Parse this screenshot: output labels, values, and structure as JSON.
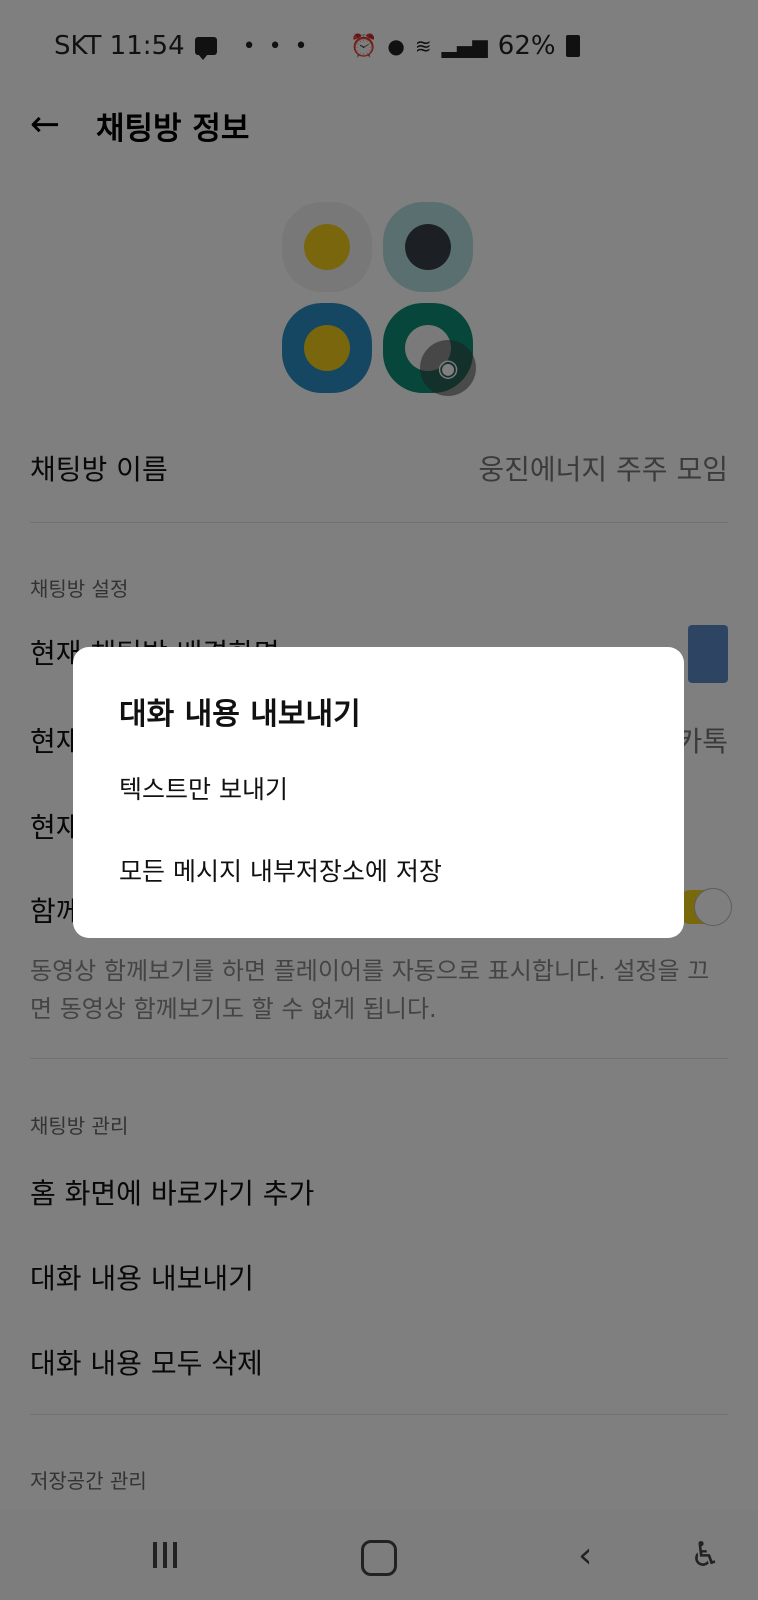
{
  "status_bar": {
    "carrier_time": "SKT 11:54",
    "dots": "• • •",
    "battery": "62%"
  },
  "header": {
    "back_icon": "←",
    "title": "채팅방 정보"
  },
  "chat_name": {
    "label": "채팅방 이름",
    "value": "웅진에너지 주주 모임"
  },
  "settings_section": {
    "title": "채팅방 설정",
    "row1_label": "현재 채팅방 배경화면",
    "row2_label": "현재 채팅방 테마",
    "row2_value": "카톡",
    "row3_label": "현재 채팅방 알림음",
    "row4_label": "함께보기",
    "description": "동영상 함께보기를 하면 플레이어를 자동으로 표시합니다. 설정을 끄면 동영상 함께보기도 할 수 없게 됩니다."
  },
  "manage_section": {
    "title": "채팅방 관리",
    "add_shortcut": "홈 화면에 바로가기 추가",
    "export_chat": "대화 내용 내보내기",
    "delete_chat": "대화 내용 모두 삭제"
  },
  "storage_section": {
    "title": "저장공간 관리"
  },
  "dialog": {
    "title": "대화 내용 내보내기",
    "option_text_only": "텍스트만 보내기",
    "option_save_all": "모든 메시지 내부저장소에 저장"
  },
  "icons": {
    "camera": "camera-icon",
    "message": "message-icon",
    "battery": "battery-icon"
  },
  "colors": {
    "toggle_accent": "#f2d21b",
    "background_swatch": "#5b8bc6"
  }
}
